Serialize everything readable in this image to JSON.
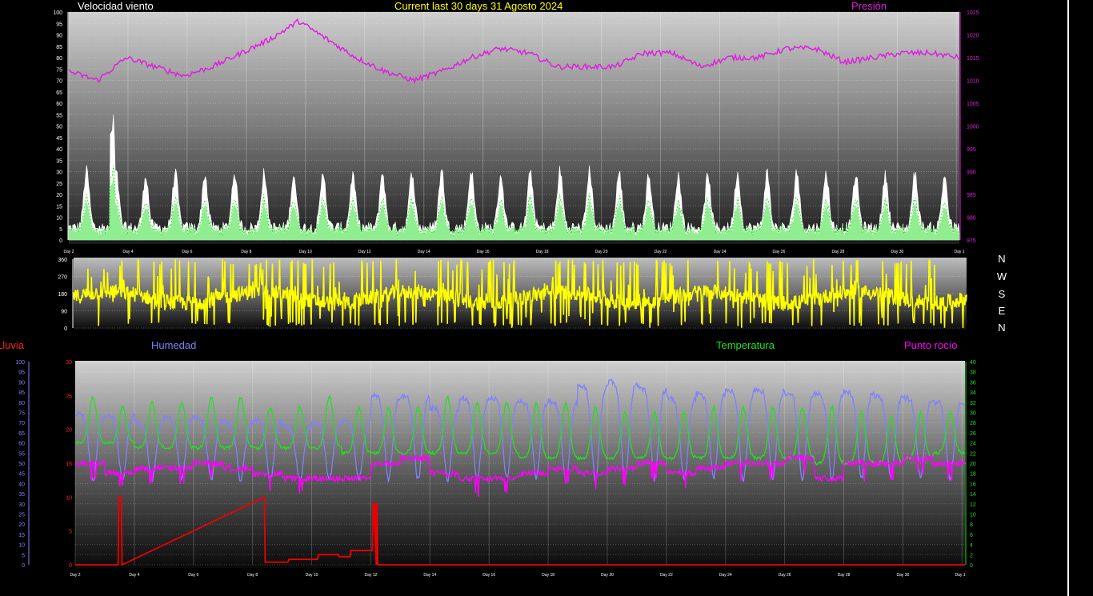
{
  "header": {
    "left_title": "Velocidad viento",
    "center_title": "Current last 30 days 31 Agosto 2024",
    "right_title": "Presión"
  },
  "bottom_header": {
    "rain_label": "Lluvia",
    "humidity_label": "Humedad",
    "temperature_label": "Temperatura",
    "dewpoint_label": "Punto rocío"
  },
  "direction_labels": [
    "N",
    "W",
    "S",
    "E",
    "N"
  ],
  "colors": {
    "wind_gust": "#ffffff",
    "wind_avg": "#90ee90",
    "wind_avg_line": "#00dd00",
    "pressure": "#e020e0",
    "direction": "#ffff00",
    "humidity": "#8080ff",
    "temperature": "#20e020",
    "dewpoint": "#ff00ff",
    "rain": "#ee0000",
    "left_title": "#ffffff",
    "center_title": "#ffff00",
    "right_title": "#e020e0"
  },
  "chart_data": [
    {
      "type": "line",
      "name": "wind_pressure",
      "title": "Current last 30 days 31 Agosto 2024",
      "x_ticks": [
        "Day 2",
        "Day 4",
        "Day 6",
        "Day 8",
        "Day 10",
        "Day 12",
        "Day 14",
        "Day 16",
        "Day 18",
        "Day 20",
        "Day 22",
        "Day 24",
        "Day 26",
        "Day 28",
        "Day 30",
        "Day 1"
      ],
      "y_left_ticks": [
        "0",
        "5",
        "10",
        "15",
        "20",
        "25",
        "30",
        "35",
        "40",
        "45",
        "50",
        "55",
        "60",
        "65",
        "70",
        "75",
        "80",
        "85",
        "90",
        "95",
        "100"
      ],
      "y_right_ticks": [
        "975",
        "980",
        "985",
        "990",
        "995",
        "1000",
        "1005",
        "1010",
        "1015",
        "1020",
        "1025"
      ],
      "ylim_left": [
        0,
        100
      ],
      "ylim_right": [
        975,
        1025
      ],
      "pressure_daily": [
        1012,
        1010,
        1015,
        1013,
        1011,
        1013,
        1016,
        1019,
        1023,
        1019,
        1015,
        1012,
        1010,
        1012,
        1015,
        1017,
        1016,
        1013,
        1013,
        1013,
        1016,
        1016,
        1013,
        1015,
        1015,
        1017,
        1017,
        1014,
        1015,
        1016,
        1016,
        1015
      ],
      "gust_peaks": [
        30,
        29,
        28,
        29,
        28,
        29,
        29,
        28,
        29,
        28,
        29,
        29,
        30,
        30,
        28,
        29,
        30,
        30,
        29,
        28,
        28,
        28,
        29,
        29,
        30,
        29,
        28,
        28,
        29,
        28,
        27
      ],
      "max_gust": 55
    },
    {
      "type": "line",
      "name": "wind_direction",
      "y_ticks": [
        "0",
        "90",
        "180",
        "270",
        "360"
      ],
      "ylim": [
        0,
        360
      ]
    },
    {
      "type": "line",
      "name": "climate",
      "x_ticks": [
        "Day 2",
        "Day 4",
        "Day 6",
        "Day 8",
        "Day 10",
        "Day 12",
        "Day 14",
        "Day 16",
        "Day 18",
        "Day 20",
        "Day 22",
        "Day 24",
        "Day 26",
        "Day 28",
        "Day 30",
        "Day 1"
      ],
      "humidity_ticks": [
        "0",
        "5",
        "10",
        "15",
        "20",
        "25",
        "30",
        "35",
        "40",
        "45",
        "50",
        "55",
        "60",
        "65",
        "70",
        "75",
        "80",
        "85",
        "90",
        "95",
        "100"
      ],
      "rain_ticks": [
        "0",
        "5",
        "10",
        "15",
        "20",
        "25",
        "30"
      ],
      "temp_ticks": [
        "0",
        "2",
        "4",
        "6",
        "8",
        "10",
        "12",
        "14",
        "16",
        "18",
        "20",
        "22",
        "24",
        "26",
        "28",
        "30",
        "32",
        "34",
        "36",
        "38",
        "40"
      ],
      "ylim_rain": [
        0,
        30
      ],
      "ylim_temp": [
        0,
        40
      ],
      "temp_max": [
        33,
        31,
        32,
        32,
        33,
        33,
        31,
        31,
        33,
        31,
        31,
        31,
        33,
        32,
        32,
        32,
        32,
        31,
        30,
        30,
        30,
        31,
        31,
        31,
        31,
        31,
        30,
        29,
        30,
        30,
        30
      ],
      "temp_min": [
        24,
        24,
        23,
        23,
        23,
        23,
        23,
        23,
        23,
        22,
        22,
        22,
        22,
        22,
        22,
        21,
        21,
        21,
        21,
        21,
        21,
        21,
        21,
        21,
        21,
        20,
        20,
        20,
        21,
        22,
        22
      ],
      "dewpoint_daily": [
        20,
        18,
        19,
        19,
        20,
        19,
        18,
        17,
        17,
        17,
        20,
        21,
        18,
        17,
        17,
        18,
        19,
        18,
        19,
        20,
        18,
        19,
        20,
        20,
        21,
        17,
        20,
        20,
        21,
        20,
        20
      ],
      "humidity_peaks": [
        74,
        74,
        70,
        72,
        72,
        70,
        71,
        68,
        70,
        71,
        83,
        83,
        77,
        82,
        82,
        80,
        80,
        88,
        90,
        87,
        82,
        84,
        86,
        86,
        84,
        84,
        85,
        83,
        82,
        80,
        78
      ],
      "rain_events": [
        [
          1.45,
          10
        ],
        [
          6.4,
          0.4
        ],
        [
          7.2,
          0.8
        ],
        [
          8.2,
          1.5
        ],
        [
          8.9,
          1.2
        ],
        [
          9.3,
          2.1
        ],
        [
          10.05,
          9
        ],
        [
          10.1,
          9
        ]
      ]
    }
  ]
}
